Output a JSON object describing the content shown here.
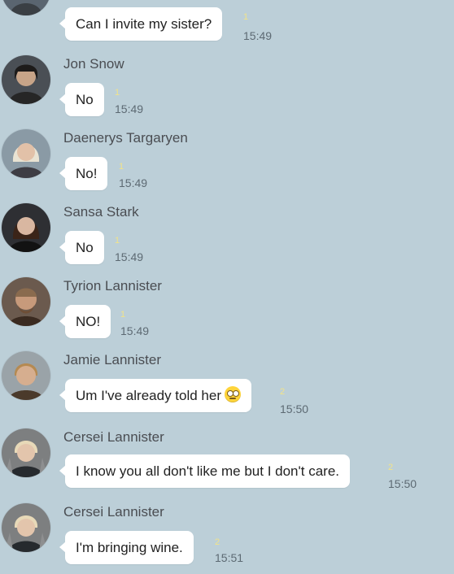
{
  "messages": [
    {
      "name": "",
      "text": "Can I invite my sister?",
      "count": "1",
      "time": "15:49",
      "avatar": "avatar-person-icon"
    },
    {
      "name": "Jon Snow",
      "text": "No",
      "count": "1",
      "time": "15:49",
      "avatar": "avatar-person-icon"
    },
    {
      "name": "Daenerys Targaryen",
      "text": "No!",
      "count": "1",
      "time": "15:49",
      "avatar": "avatar-person-icon"
    },
    {
      "name": "Sansa Stark",
      "text": "No",
      "count": "1",
      "time": "15:49",
      "avatar": "avatar-person-icon"
    },
    {
      "name": "Tyrion Lannister",
      "text": "NO!",
      "count": "1",
      "time": "15:49",
      "avatar": "avatar-person-icon"
    },
    {
      "name": "Jamie Lannister",
      "text": "Um I've already told her",
      "emoji": "face-with-rolling-eyes-icon",
      "count": "2",
      "time": "15:50",
      "avatar": "avatar-person-icon"
    },
    {
      "name": "Cersei Lannister",
      "text": "I know you all don't like me but I don't care.",
      "count": "2",
      "time": "15:50",
      "avatar": "avatar-person-icon"
    },
    {
      "name": "Cersei Lannister",
      "text": "I'm bringing wine.",
      "count": "2",
      "time": "15:51",
      "avatar": "avatar-person-icon"
    }
  ],
  "colors": {
    "background": "#bccfd8",
    "bubble": "#ffffff",
    "count": "#f1e38a",
    "time": "#5d6a73"
  }
}
